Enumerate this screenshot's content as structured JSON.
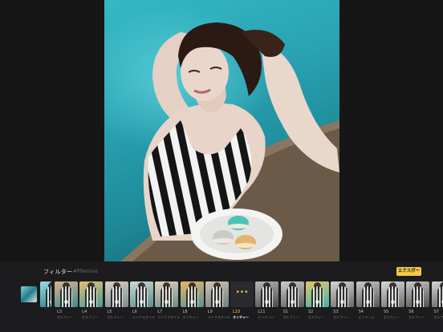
{
  "panel": {
    "title": "フィルター",
    "tag": "#filterious",
    "export_label": "エクスポート",
    "more_label": "•••",
    "accent": "#f2c94c"
  },
  "filters": [
    {
      "code": "",
      "name": "",
      "colors": [
        "#9fd9dc",
        "#2a8f99"
      ],
      "partial": true
    },
    {
      "code": "L3",
      "name": "セルフィー",
      "colors": [
        "#d8b48a",
        "#3a8c90"
      ]
    },
    {
      "code": "L4",
      "name": "セルフィー",
      "colors": [
        "#e2c07b",
        "#4a9a8c"
      ]
    },
    {
      "code": "L5",
      "name": "セルフィー",
      "colors": [
        "#d9d2c6",
        "#7a8a8c"
      ]
    },
    {
      "code": "L6",
      "name": "ライフスタイル",
      "colors": [
        "#cfd8d2",
        "#5a8f8a"
      ]
    },
    {
      "code": "L7",
      "name": "ライフスタイル",
      "colors": [
        "#e0d5bf",
        "#6b8d86"
      ]
    },
    {
      "code": "L8",
      "name": "ネイチャー",
      "colors": [
        "#e8b46a",
        "#57938a"
      ]
    },
    {
      "code": "L9",
      "name": "ライフスタイル",
      "colors": [
        "#d3c3b3",
        "#6f7f80"
      ]
    },
    {
      "code": "L10",
      "name": "ネイチャー",
      "more": true,
      "active": true
    },
    {
      "code": "L11",
      "name": "ビンテージ",
      "colors": [
        "#b8b8b8",
        "#4a4a4a"
      ]
    },
    {
      "code": "S1",
      "name": "セルフィー",
      "colors": [
        "#cfcfcf",
        "#5a5a5a"
      ]
    },
    {
      "code": "S2",
      "name": "セルフィー",
      "colors": [
        "#e5c76a",
        "#3fb3b0"
      ]
    },
    {
      "code": "S3",
      "name": "セルフィー",
      "colors": [
        "#d4d4d4",
        "#6a6a6a"
      ]
    },
    {
      "code": "S4",
      "name": "ビンテージ",
      "colors": [
        "#cacaca",
        "#555555"
      ]
    },
    {
      "code": "S5",
      "name": "セルフィー",
      "colors": [
        "#d9d9d9",
        "#6e6e6e"
      ]
    },
    {
      "code": "S6",
      "name": "セルフィー",
      "colors": [
        "#c9c9c9",
        "#4f4f4f"
      ]
    },
    {
      "code": "S7",
      "name": "セルフィー",
      "colors": [
        "#d6d6d6",
        "#5d5d5d"
      ]
    }
  ]
}
